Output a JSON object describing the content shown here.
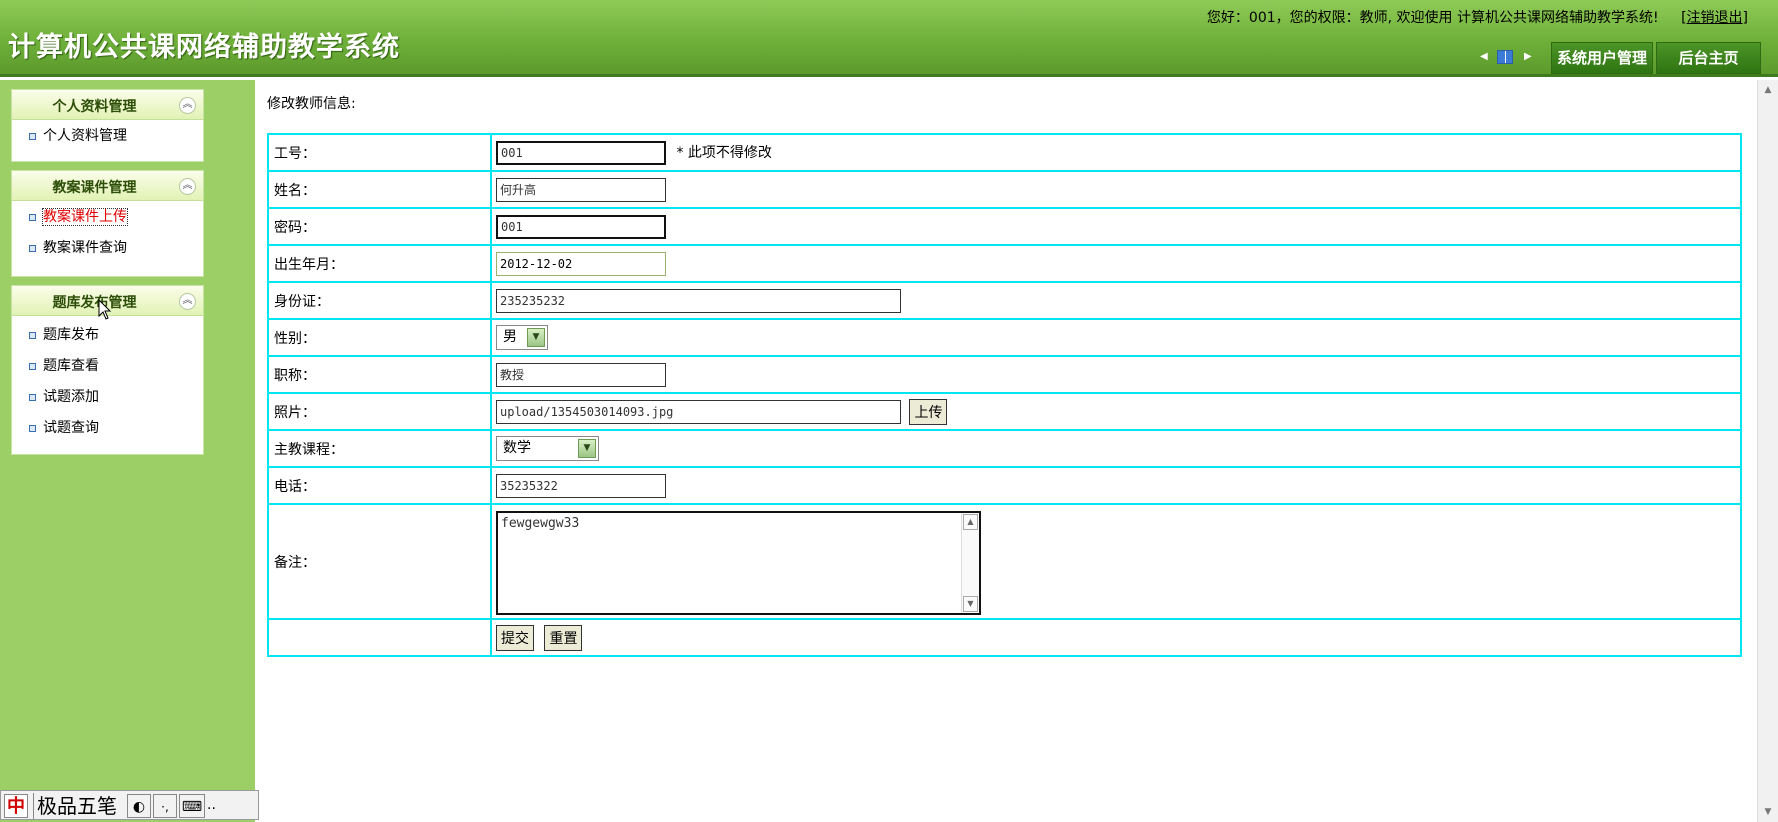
{
  "header": {
    "title": "计算机公共课网络辅助教学系统",
    "welcome": "您好：001，您的权限：教师, 欢迎使用 计算机公共课网络辅助教学系统!",
    "logout_label": "注销退出",
    "nav_buttons": [
      "系统用户管理",
      "后台主页"
    ]
  },
  "sidebar": {
    "panels": [
      {
        "title": "个人资料管理",
        "items": [
          "个人资料管理"
        ]
      },
      {
        "title": "教案课件管理",
        "items": [
          "教案课件上传",
          "教案课件查询"
        ]
      },
      {
        "title": "题库发布管理",
        "items": [
          "题库发布",
          "题库查看",
          "试题添加",
          "试题查询"
        ]
      }
    ]
  },
  "form": {
    "heading": "修改教师信息:",
    "fields": {
      "id": {
        "label": "工号：",
        "value": "001",
        "note": "* 此项不得修改"
      },
      "name": {
        "label": "姓名：",
        "value": "何升高"
      },
      "password": {
        "label": "密码：",
        "value": "001"
      },
      "birth": {
        "label": "出生年月：",
        "value": "2012-12-02"
      },
      "idcard": {
        "label": "身份证：",
        "value": "235235232"
      },
      "gender": {
        "label": "性别：",
        "value": "男"
      },
      "title": {
        "label": "职称：",
        "value": "教授"
      },
      "photo": {
        "label": "照片：",
        "value": "upload/1354503014093.jpg",
        "button": "上传"
      },
      "course": {
        "label": "主教课程：",
        "value": "数学"
      },
      "phone": {
        "label": "电话：",
        "value": "35235322"
      },
      "remark": {
        "label": "备注：",
        "value": "fewgewgw33"
      }
    },
    "submit_label": "提交",
    "reset_label": "重置"
  },
  "ime": {
    "logo": "中",
    "name": "极品五笔",
    "more": ".."
  }
}
